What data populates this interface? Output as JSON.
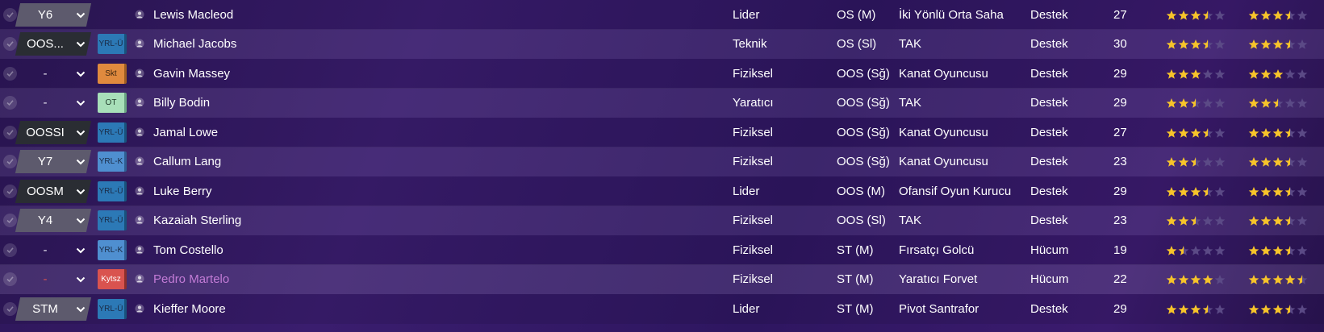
{
  "colors": {
    "star_full": "#f7c42a",
    "star_empty": "#5b4a86",
    "pink_name": "#c27bd6"
  },
  "players": [
    {
      "position": "Y6",
      "pos_style": "grey",
      "role_badge": "",
      "badge_style": "",
      "name": "Lewis Macleod",
      "name_style": "",
      "personality": "Lider",
      "pos": "OS (M)",
      "role": "İki Yönlü Orta Saha",
      "duty": "Destek",
      "age": "27",
      "current_ability": 3.5,
      "potential_ability": 3.5
    },
    {
      "position": "OOS...",
      "pos_style": "dark",
      "role_badge": "YRL-Ü",
      "badge_style": "blue",
      "name": "Michael Jacobs",
      "name_style": "",
      "personality": "Teknik",
      "pos": "OS (Sl)",
      "role": "TAK",
      "duty": "Destek",
      "age": "30",
      "current_ability": 3.5,
      "potential_ability": 3.5
    },
    {
      "position": "-",
      "pos_style": "empty",
      "role_badge": "Skt",
      "badge_style": "orange",
      "name": "Gavin Massey",
      "name_style": "",
      "personality": "Fiziksel",
      "pos": "OOS (Sğ)",
      "role": "Kanat Oyuncusu",
      "duty": "Destek",
      "age": "29",
      "current_ability": 3,
      "potential_ability": 3
    },
    {
      "position": "-",
      "pos_style": "empty",
      "role_badge": "OT",
      "badge_style": "green",
      "name": "Billy Bodin",
      "name_style": "",
      "personality": "Yaratıcı",
      "pos": "OOS (Sğ)",
      "role": "TAK",
      "duty": "Destek",
      "age": "29",
      "current_ability": 2.5,
      "potential_ability": 2.5
    },
    {
      "position": "OOSSI",
      "pos_style": "dark",
      "role_badge": "YRL-Ü",
      "badge_style": "blue",
      "name": "Jamal Lowe",
      "name_style": "",
      "personality": "Fiziksel",
      "pos": "OOS (Sğ)",
      "role": "Kanat Oyuncusu",
      "duty": "Destek",
      "age": "27",
      "current_ability": 3.5,
      "potential_ability": 3.5
    },
    {
      "position": "Y7",
      "pos_style": "grey",
      "role_badge": "YRL-K",
      "badge_style": "lightblue",
      "name": "Callum Lang",
      "name_style": "",
      "personality": "Fiziksel",
      "pos": "OOS (Sğ)",
      "role": "Kanat Oyuncusu",
      "duty": "Destek",
      "age": "23",
      "current_ability": 2.5,
      "potential_ability": 3.5
    },
    {
      "position": "OOSM",
      "pos_style": "dark",
      "role_badge": "YRL-Ü",
      "badge_style": "blue",
      "name": "Luke Berry",
      "name_style": "",
      "personality": "Lider",
      "pos": "OOS (M)",
      "role": "Ofansif Oyun Kurucu",
      "duty": "Destek",
      "age": "29",
      "current_ability": 3.5,
      "potential_ability": 3.5
    },
    {
      "position": "Y4",
      "pos_style": "grey",
      "role_badge": "YRL-Ü",
      "badge_style": "blue",
      "name": "Kazaiah Sterling",
      "name_style": "",
      "personality": "Fiziksel",
      "pos": "OOS (Sl)",
      "role": "TAK",
      "duty": "Destek",
      "age": "23",
      "current_ability": 2.5,
      "potential_ability": 3.5
    },
    {
      "position": "-",
      "pos_style": "empty",
      "role_badge": "YRL-K",
      "badge_style": "lightblue",
      "name": "Tom Costello",
      "name_style": "",
      "personality": "Fiziksel",
      "pos": "ST (M)",
      "role": "Fırsatçı Golcü",
      "duty": "Hücum",
      "age": "19",
      "current_ability": 1.5,
      "potential_ability": 3.5
    },
    {
      "position": "-",
      "pos_style": "empty red",
      "role_badge": "Kytsz",
      "badge_style": "red",
      "name": "Pedro Martelo",
      "name_style": "pink",
      "personality": "Fiziksel",
      "pos": "ST (M)",
      "role": "Yaratıcı Forvet",
      "duty": "Hücum",
      "age": "22",
      "current_ability": 4,
      "potential_ability": 4.5
    },
    {
      "position": "STM",
      "pos_style": "grey",
      "role_badge": "YRL-Ü",
      "badge_style": "blue",
      "name": "Kieffer Moore",
      "name_style": "",
      "personality": "Lider",
      "pos": "ST (M)",
      "role": "Pivot Santrafor",
      "duty": "Destek",
      "age": "29",
      "current_ability": 3.5,
      "potential_ability": 3.5
    }
  ]
}
